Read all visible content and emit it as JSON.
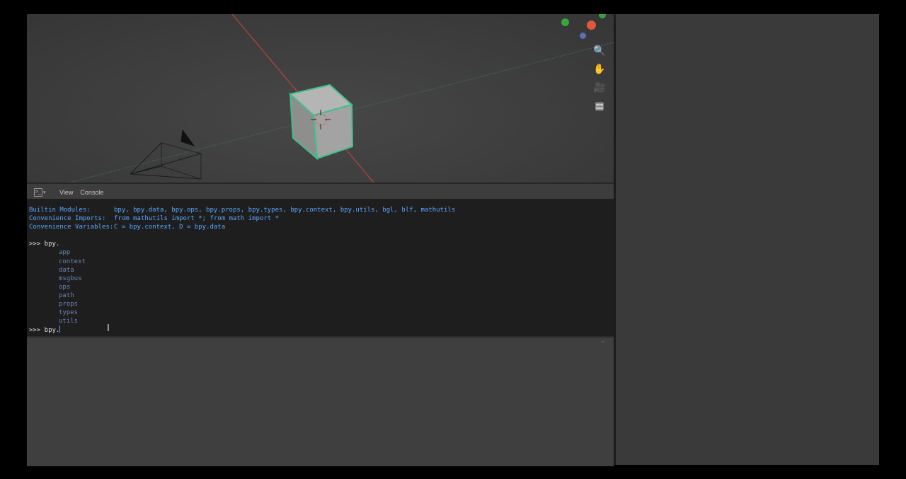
{
  "viewport": {
    "gizmo_colors": {
      "x": "#e0583a",
      "y": "#3aa33a",
      "z": "#5b6fb5"
    },
    "nav_tools": [
      {
        "icon": "zoom-icon",
        "glyph": "🔍"
      },
      {
        "icon": "pan-hand-icon",
        "glyph": "✋"
      },
      {
        "icon": "camera-view-icon",
        "glyph": "🎥"
      },
      {
        "icon": "perspective-grid-icon",
        "glyph": "▦"
      }
    ]
  },
  "console": {
    "header": {
      "editor_type_glyph": ">_",
      "menus": [
        "View",
        "Console"
      ]
    },
    "info_lines": [
      {
        "key": "Builtin Modules:",
        "value": "bpy, bpy.data, bpy.ops, bpy.props, bpy.types, bpy.context, bpy.utils, bgl, blf, mathutils"
      },
      {
        "key": "Convenience Imports:",
        "value": "from mathutils import *; from math import *"
      },
      {
        "key": "Convenience Variables:",
        "value": "C = bpy.context, D = bpy.data"
      }
    ],
    "first_prompt": ">>> bpy.",
    "candidates": [
      "app",
      "context",
      "data",
      "msgbus",
      "ops",
      "path",
      "props",
      "types",
      "utils"
    ],
    "current_prompt": ">>> bpy."
  },
  "lower_area": {
    "collapse_glyph": "⌄"
  }
}
